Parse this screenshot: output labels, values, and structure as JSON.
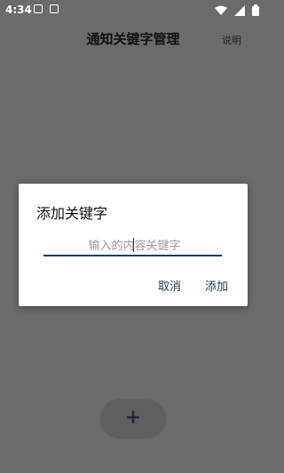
{
  "status_bar": {
    "time": "4:34",
    "left_icons": [
      "image-icon",
      "app-a-icon"
    ],
    "right_icons": [
      "wifi-icon",
      "signal-icon",
      "battery-icon"
    ]
  },
  "header": {
    "title": "通知关键字管理",
    "help_label": "说明"
  },
  "dialog": {
    "title": "添加关键字",
    "input_placeholder": "输入的内容关键字",
    "input_value": "",
    "cancel_label": "取消",
    "confirm_label": "添加"
  },
  "fab": {
    "label": "+"
  },
  "colors": {
    "accent": "#1c3b66",
    "overlay": "#6b6b6b",
    "dialog_bg": "#ffffff"
  }
}
